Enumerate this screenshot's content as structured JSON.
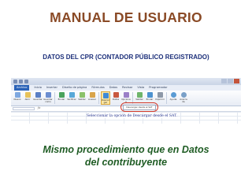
{
  "title": "MANUAL DE USUARIO",
  "subtitle": "DATOS DEL CPR (CONTADOR PÚBLICO REGISTRADO)",
  "screenshot": {
    "tabs": [
      "Archivo",
      "Inicio",
      "Insertar",
      "Diseño de página",
      "Fórmulas",
      "Datos",
      "Revisar",
      "Vista",
      "Programador"
    ],
    "ribbon_buttons": [
      "Nuevo",
      "Abrir",
      "Guardar",
      "Guardar como",
      "Enviar",
      "Verificar",
      "Validar",
      "Anexar",
      "Descargar",
      "Datos",
      "Opciones",
      "Validar",
      "Enviar",
      "Imprimir",
      "Ayuda",
      "Acerca de"
    ],
    "instruction": "Seleccionar la opción de Descargar desde el SAT.",
    "tooltip": "Descargar desde el SAT"
  },
  "caption_line1": "Mismo procedimiento que en Datos",
  "caption_line2": "del contribuyente",
  "colors": {
    "title": "#8a4a26",
    "subtitle": "#1c2f7a",
    "caption": "#1f5c24",
    "highlight": "#d23a2a"
  }
}
